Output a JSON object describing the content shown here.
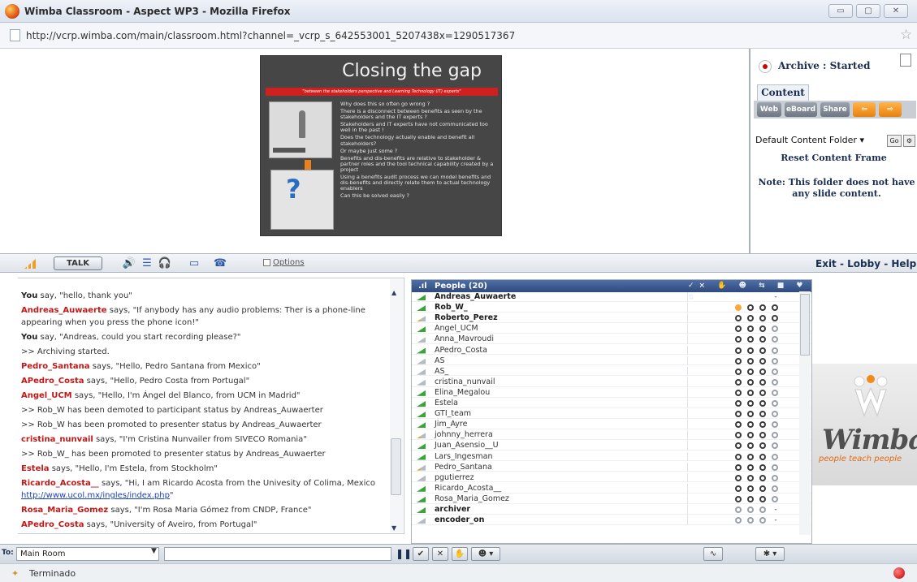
{
  "window": {
    "title": "Wimba Classroom - Aspect WP3 - Mozilla Firefox",
    "url": "http://vcrp.wimba.com/main/classroom.html?channel=_vcrp_s_642553001_5207438x=1290517367"
  },
  "slide": {
    "title": "Closing the gap",
    "banner": "\"between the stakeholders perspective and Learning Technology (IT) experts\"",
    "body": [
      "Why does this so often go wrong ?",
      "There is a disconnect between benefits as seen by the stakeholders and the IT experts ?",
      "Stakeholders and IT experts have not communicated too well in the past !",
      "Does the technology actually enable and benefit all stakeholders?",
      "Or maybe just some ?",
      "Benefits and dis-benefits are relative to stakeholder & partner roles and the tool technical capability created by a project",
      "Using a benefits audit process we can model benefits and dis-benefits and directly relate them to actual technology enablers",
      "Can this be solved easily ?"
    ]
  },
  "right_panel": {
    "archive_status": "Archive : Started",
    "content_tab": "Content",
    "buttons": {
      "web": "Web",
      "eboard": "eBoard",
      "share": "Share"
    },
    "folder_select": "Default Content Folder",
    "go": "Go",
    "reset": "Reset Content Frame",
    "note": "Note: This folder does not have any slide content."
  },
  "toolbar": {
    "talk": "TALK",
    "options": "Options",
    "exit_lobby_help": "Exit - Lobby - Help"
  },
  "chat": {
    "messages": [
      {
        "who": "You",
        "you": true,
        "text": " say, \"hello, thank you\""
      },
      {
        "who": "Andreas_Auwaerte",
        "text": " says, \"If anybody has any audio problems: Ther is a phone-line appearing when you press the phone icon!\""
      },
      {
        "who": "You",
        "you": true,
        "text": " say, \"Andreas, could you start recording please?\""
      },
      {
        "sys": true,
        "text": ">> Archiving started."
      },
      {
        "who": "Pedro_Santana",
        "text": " says, \"Hello, Pedro Santana from Mexico\""
      },
      {
        "who": "APedro_Costa",
        "text": " says, \"Hello, Pedro Costa from Portugal\""
      },
      {
        "who": "Angel_UCM",
        "text": " says, \"Hello, I'm Ángel del Blanco, from UCM in Madrid\""
      },
      {
        "sys": true,
        "text": ">> Rob_W has been demoted to participant status by Andreas_Auwaerter"
      },
      {
        "sys": true,
        "text": ">> Rob_W has been promoted to presenter status by Andreas_Auwaerter"
      },
      {
        "who": "cristina_nunvail",
        "text": " says, \"I'm Cristina Nunvailer from SIVECO Romania\""
      },
      {
        "sys": true,
        "text": ">> Rob_W_ has been promoted to presenter status by Andreas_Auwaerter"
      },
      {
        "who": "Estela",
        "text": " says, \"Hello, I'm Estela, from Stockholm\""
      },
      {
        "who": "Ricardo_Acosta__",
        "text": " says, \"Hi, I am Ricardo Acosta from the Univesity of Colima, Mexico ",
        "link": "http://www.ucol.mx/ingles/index.php",
        "after": "\""
      },
      {
        "who": "Rosa_Maria_Gomez",
        "text": " says, \"I'm Rosa Maria Gómez from CNDP, France\""
      },
      {
        "who": "APedro_Costa",
        "text": " says, \"University of Aveiro, from Portugal\""
      }
    ]
  },
  "people": {
    "title": "People (20)",
    "header_icons": "✓× ✋ ☻ ⇆ ■ ♥ ⇅",
    "rows": [
      {
        "name": "Andreas_Auwaerte",
        "bold": true,
        "sig": "green",
        "c1": "",
        "dots": [
          "",
          "",
          "",
          ""
        ]
      },
      {
        "name": "Rob_W_",
        "bold": true,
        "sig": "green",
        "dots": [
          "orange",
          "d",
          "d",
          "d"
        ]
      },
      {
        "name": "Roberto_Perez",
        "bold": true,
        "sig": "mix",
        "dots": [
          "d",
          "d",
          "d",
          "d"
        ]
      },
      {
        "name": "Angel_UCM",
        "sig": "green",
        "dots": [
          "d",
          "d",
          "d",
          "lt"
        ]
      },
      {
        "name": "Anna_Mavroudi",
        "sig": "gray",
        "dots": [
          "d",
          "d",
          "d",
          "lt"
        ]
      },
      {
        "name": "APedro_Costa",
        "sig": "green",
        "dots": [
          "d",
          "d",
          "d",
          "lt"
        ]
      },
      {
        "name": "AS",
        "sig": "gray",
        "dots": [
          "d",
          "d",
          "d",
          "lt"
        ]
      },
      {
        "name": "AS_",
        "sig": "gray",
        "dots": [
          "d",
          "d",
          "d",
          "lt"
        ]
      },
      {
        "name": "cristina_nunvail",
        "sig": "gray",
        "dots": [
          "d",
          "d",
          "d",
          "lt"
        ]
      },
      {
        "name": "Elina_Megalou",
        "sig": "green",
        "dots": [
          "d",
          "d",
          "d",
          "lt"
        ]
      },
      {
        "name": "Estela",
        "sig": "green",
        "dots": [
          "d",
          "d",
          "d",
          "lt"
        ]
      },
      {
        "name": "GTI_team",
        "sig": "green",
        "dots": [
          "d",
          "d",
          "d",
          "lt"
        ]
      },
      {
        "name": "Jim_Ayre",
        "sig": "green",
        "dots": [
          "d",
          "d",
          "d",
          "lt"
        ]
      },
      {
        "name": "johnny_herrera",
        "sig": "mix",
        "dots": [
          "d",
          "d",
          "d",
          "lt"
        ]
      },
      {
        "name": "Juan_Asensio__U",
        "sig": "green",
        "dots": [
          "d",
          "d",
          "d",
          "lt"
        ]
      },
      {
        "name": "Lars_Ingesman",
        "sig": "green",
        "dots": [
          "d",
          "d",
          "d",
          "lt"
        ]
      },
      {
        "name": "Pedro_Santana",
        "sig": "mix",
        "dots": [
          "d",
          "d",
          "d",
          "lt"
        ]
      },
      {
        "name": "pgutierrez",
        "sig": "gray",
        "dots": [
          "d",
          "d",
          "d",
          "lt"
        ]
      },
      {
        "name": "Ricardo_Acosta__",
        "sig": "green",
        "dots": [
          "d",
          "d",
          "d",
          "lt"
        ]
      },
      {
        "name": "Rosa_Maria_Gomez",
        "sig": "green",
        "dots": [
          "d",
          "d",
          "d",
          "lt"
        ]
      },
      {
        "name": "archiver",
        "bold": true,
        "sig": "green",
        "dots": [
          "lt",
          "lt",
          "lt",
          "-"
        ]
      },
      {
        "name": "encoder_on",
        "bold": true,
        "sig": "gray",
        "dots": [
          "lt",
          "lt",
          "lt",
          "-"
        ]
      }
    ],
    "dash_first": "-"
  },
  "wimba": {
    "word": "Wimba",
    "tagline": "people teach people"
  },
  "bottom": {
    "to": "To:",
    "room": "Main Room"
  },
  "status": {
    "text": "Terminado"
  }
}
